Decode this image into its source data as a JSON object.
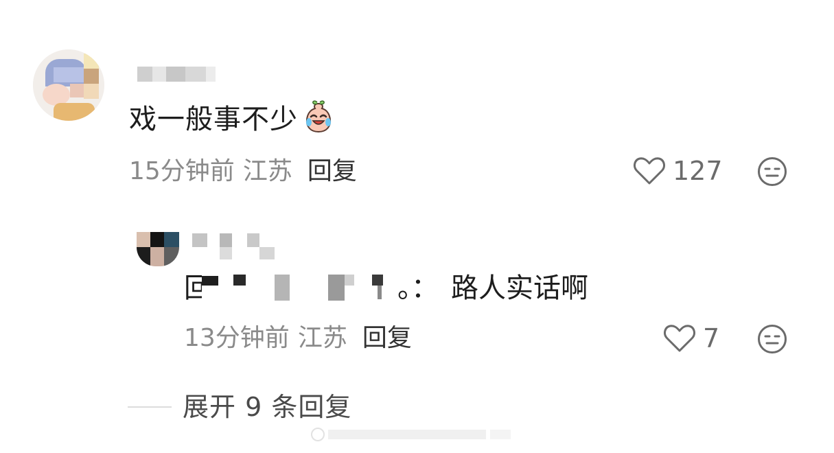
{
  "comment": {
    "text": "戏一般事不少",
    "emoji_icon": "crying-laughing-face-icon",
    "time": "15分钟前",
    "location": "江苏",
    "reply_label": "回复",
    "likes": "127"
  },
  "reply": {
    "prefix": "回",
    "quote_tail": "。：",
    "text": "路人实话啊",
    "time": "13分钟前",
    "location": "江苏",
    "reply_label": "回复",
    "likes": "7"
  },
  "expand": {
    "label": "展开 9 条回复"
  },
  "colors": {
    "meta_gray": "#8a8a8a",
    "text_dark": "#1d1d1d",
    "icon_gray": "#6b6b6b"
  }
}
